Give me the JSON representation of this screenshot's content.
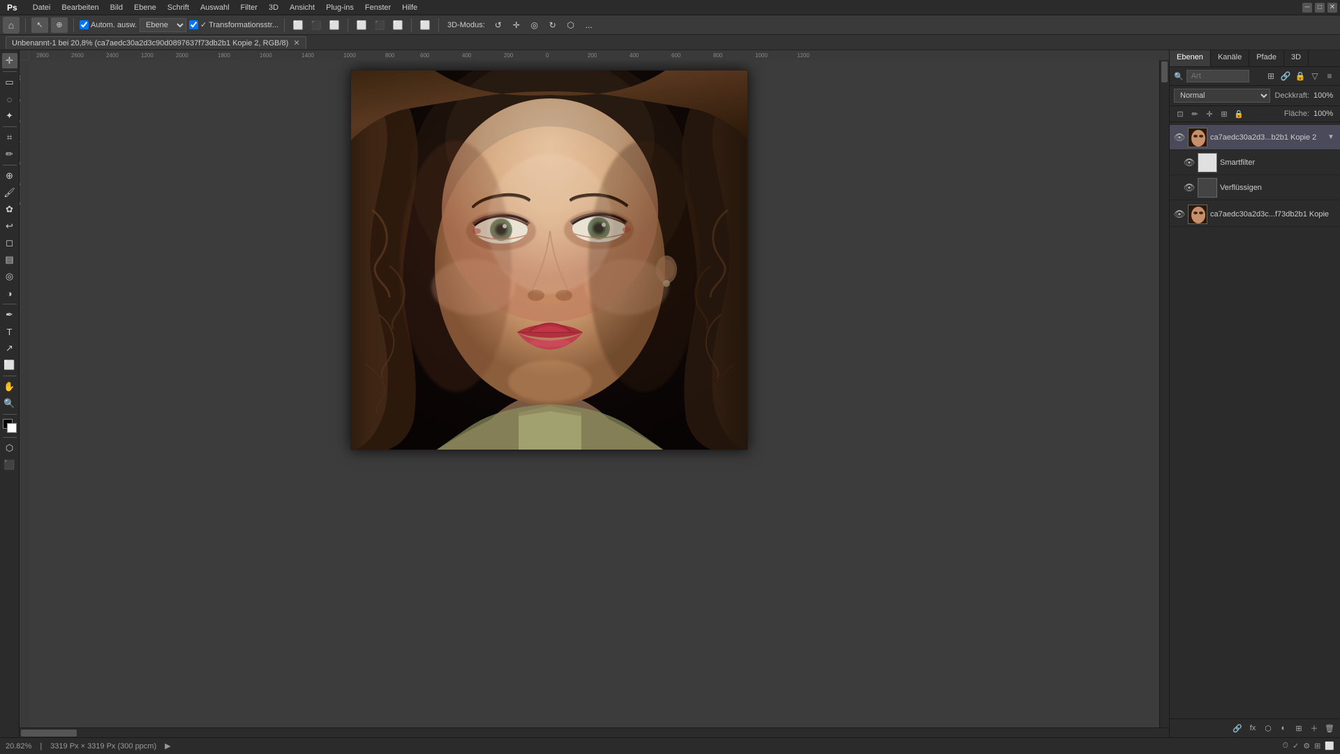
{
  "app": {
    "title": "Adobe Photoshop",
    "name": "Ps"
  },
  "menubar": {
    "items": [
      "Datei",
      "Bearbeiten",
      "Bild",
      "Ebene",
      "Schrift",
      "Auswahl",
      "Filter",
      "3D",
      "Ansicht",
      "Plug-ins",
      "Fenster",
      "Hilfe"
    ],
    "window_controls": [
      "—",
      "□",
      "✕"
    ]
  },
  "toolbar": {
    "home_icon": "⌂",
    "mode_label": "Ebene",
    "autoselect_label": "Autom. ausw.",
    "transform_label": "✓ Transformationsstr...",
    "mode_3d": "3D-Modus:",
    "more_icon": "..."
  },
  "tab": {
    "title": "Unbenannt-1 bei 20,8% (ca7aedc30a2d3c90d0897637f73db2b1 Kopie 2, RGB/8)",
    "close": "✕"
  },
  "layers_panel": {
    "tabs": [
      "Ebenen",
      "Kanäle",
      "Pfade",
      "3D"
    ],
    "search_placeholder": "Art",
    "blend_mode": "Normal",
    "opacity_label": "Deckkraft:",
    "opacity_value": "100%",
    "fill_label": "Fläche:",
    "fill_value": "100%",
    "layers": [
      {
        "id": "layer1",
        "name": "ca7aedc30a2d3...b2b1 Kopie 2",
        "visible": true,
        "type": "smart",
        "active": true,
        "thumbnail": "face",
        "children": [
          {
            "id": "smartfilter1",
            "name": "Smartfilter",
            "visible": true,
            "type": "smartfilter",
            "thumbnail": "white"
          },
          {
            "id": "verflussigen",
            "name": "Verflüssigen",
            "visible": true,
            "type": "filter",
            "thumbnail": "empty"
          }
        ]
      },
      {
        "id": "layer2",
        "name": "ca7aedc30a2d3c...f73db2b1 Kopie",
        "visible": true,
        "type": "normal",
        "active": false,
        "thumbnail": "face",
        "children": []
      }
    ]
  },
  "statusbar": {
    "zoom": "20.82%",
    "dimensions": "3319 Px × 3319 Px (300 ppcm)",
    "arrow": "▶"
  },
  "colors": {
    "active_layer_bg": "#4a4a5a",
    "panel_bg": "#2b2b2b",
    "toolbar_bg": "#3a3a3a",
    "canvas_bg": "#3c3c3c",
    "accent": "#4a90d9"
  }
}
